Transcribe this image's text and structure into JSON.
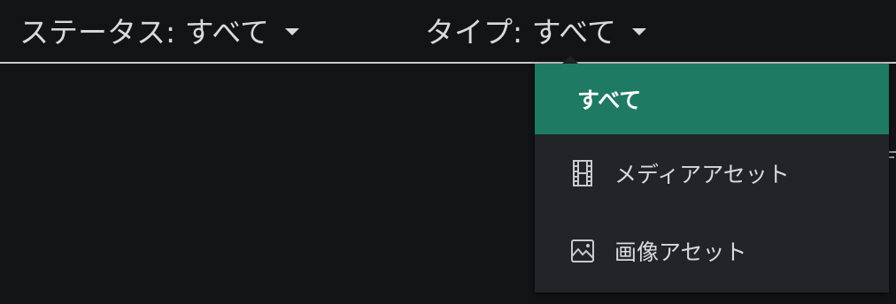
{
  "filters": {
    "status": {
      "label": "ステータス: すべて",
      "icon": "caret-down-icon"
    },
    "type": {
      "label": "タイプ: すべて",
      "icon": "caret-down-icon"
    }
  },
  "type_menu": {
    "items": [
      {
        "label": "すべて",
        "selected": true
      },
      {
        "label": "メディアアセット",
        "icon": "film-icon"
      },
      {
        "label": "画像アセット",
        "icon": "image-icon"
      }
    ]
  },
  "colors": {
    "background": "#131416",
    "menu_background": "#232428",
    "selected_background": "#1f7a63",
    "text": "#d9dadc"
  }
}
